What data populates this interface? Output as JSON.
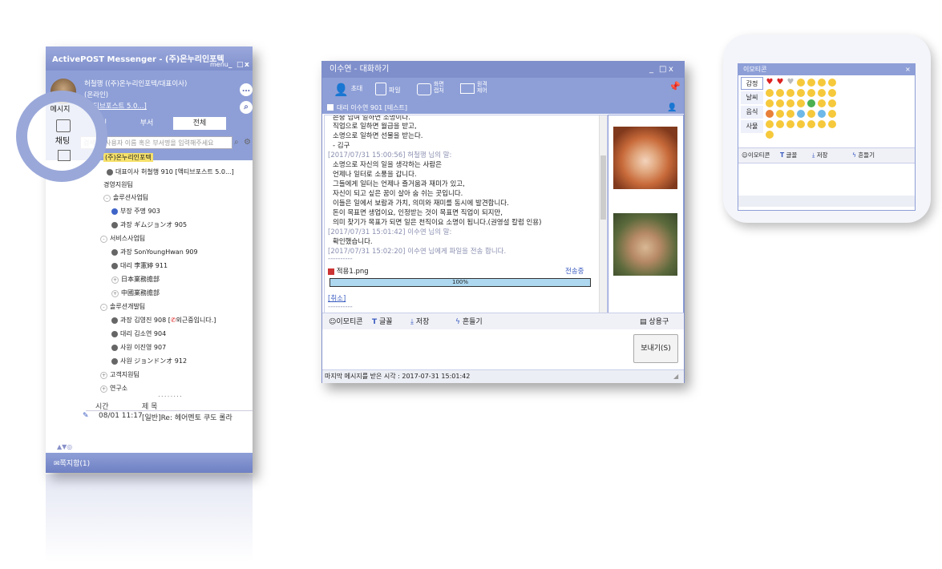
{
  "messenger": {
    "title": "ActivePOST Messenger - (주)온누리인포텍",
    "menu_label": "menu",
    "window_controls": [
      "_",
      "□",
      "x"
    ],
    "profile": {
      "name": "허철행 ((주)온누리인포텍/대표이사)",
      "status": "(온라인)",
      "memo": "[액티브포스트 5.0...]"
    },
    "tabs": [
      {
        "label": "개인"
      },
      {
        "label": "부서"
      },
      {
        "label": "전체",
        "active": true
      }
    ],
    "search": {
      "placeholder": "검색 할 사용자 이름 혹은 부서명을 입력해주세요"
    },
    "side_items": [
      {
        "label": "메시지"
      },
      {
        "label": "채팅"
      }
    ],
    "tree": [
      {
        "text": "(주)온누리인포텍",
        "type": "org"
      },
      {
        "text": "대표이사 허철행 910 [액티브포스트 5.0...]",
        "type": "person"
      },
      {
        "text": "경영지원팀",
        "type": "group"
      },
      {
        "text": "솔루션사업팀",
        "type": "group"
      },
      {
        "text": "부장 주명 903",
        "type": "person",
        "color": "blue"
      },
      {
        "text": "과장 ギムジョンオ 905",
        "type": "person"
      },
      {
        "text": "서비스사업팀",
        "type": "group"
      },
      {
        "text": "과장 SonYoungHwan 909",
        "type": "person"
      },
      {
        "text": "대리 李憲婷 911",
        "type": "person"
      },
      {
        "text": "日本業務擔部",
        "type": "group"
      },
      {
        "text": "中國業務擔部",
        "type": "group"
      },
      {
        "text": "솔루션개발팀",
        "type": "group"
      },
      {
        "text": "과장 김영진 908 [",
        "type": "person",
        "suffix": "외근중입니다.]"
      },
      {
        "text": "대리 김소연 904",
        "type": "person"
      },
      {
        "text": "사원 이진영 907",
        "type": "person"
      },
      {
        "text": "사원 ジョンドンオ 912",
        "type": "person"
      },
      {
        "text": "고객지원팀",
        "type": "group"
      },
      {
        "text": "연구소",
        "type": "group"
      }
    ],
    "mail": {
      "col_time": "시간",
      "col_subject": "제  목",
      "rows": [
        {
          "time": "08/01 11:17",
          "subject": "[일반]Re: 헤어멘토 쿠도 롤라"
        }
      ]
    },
    "status_label": "쪽지함(1)"
  },
  "chat": {
    "title": "이수연 - 대화하기",
    "window_controls": [
      "_",
      "□",
      "x"
    ],
    "toolbar": [
      {
        "label": "초대",
        "icon": "invite-icon"
      },
      {
        "label": "파일",
        "icon": "file-icon"
      },
      {
        "label": "화면\n캡처",
        "icon": "camera-icon"
      },
      {
        "label": "원격\n제어",
        "icon": "monitor-icon"
      }
    ],
    "participant": "대리 이수연 901 [테스트]",
    "log": [
      {
        "text": "존중 님여 일하면 소명이다.",
        "kind": "msg"
      },
      {
        "text": "직업으로 일하면 월급을 받고,",
        "kind": "msg"
      },
      {
        "text": "소명으로 일하면 선물을 받는다.",
        "kind": "msg"
      },
      {
        "text": "- 김구",
        "kind": "msg"
      },
      {
        "text": "[2017/07/31 15:00:56] 허철행 님의 말:",
        "kind": "meta"
      },
      {
        "text": "소명으로 자신의 일을 생각하는 사람은",
        "kind": "msg"
      },
      {
        "text": "언제나 일터로 소풍을 갑니다.",
        "kind": "msg"
      },
      {
        "text": "그들에게 일터는 언제나 즐거움과 재미가 있고,",
        "kind": "msg"
      },
      {
        "text": "자신이 되고 싶은 꿈이 살아 숨 쉬는 곳입니다.",
        "kind": "msg"
      },
      {
        "text": "이들은 일에서 보람과 가치, 의미와 재미를 동시에 발견합니다.",
        "kind": "msg"
      },
      {
        "text": "돈이 목표면 생업이요, 인정받는 것이 목표면 직업이 되지만,",
        "kind": "msg"
      },
      {
        "text": "의미 찾기가 목표가 되면 일은 천직이요 소명이 됩니다.(권영설 칼럼 인용)",
        "kind": "msg"
      },
      {
        "text": "[2017/07/31 15:01:42] 이수연 님의 말:",
        "kind": "meta"
      },
      {
        "text": "확인했습니다.",
        "kind": "msg"
      },
      {
        "text": "[2017/07/31 15:02:20] 이수연 님에게 파일을 전송 합니다.",
        "kind": "meta"
      },
      {
        "text": "----------",
        "kind": "meta"
      }
    ],
    "file": {
      "name": "적용1.png",
      "status": "전송중",
      "progress_label": "100%",
      "progress": 1.0
    },
    "cancel_label": "[취소]",
    "input_tools": [
      {
        "label": "이모티콘"
      },
      {
        "label": "글꼴"
      },
      {
        "label": "저장"
      },
      {
        "label": "흔들기"
      }
    ],
    "phrases_label": "상용구",
    "send_label": "보내기(S)",
    "status_text": "마지막 메시지를 받은 시각 : 2017-07-31 15:01:42"
  },
  "emoticon": {
    "title": "이모티콘",
    "close": "×",
    "categories": [
      {
        "label": "감정",
        "active": true
      },
      {
        "label": "날씨"
      },
      {
        "label": "음식"
      },
      {
        "label": "사물"
      }
    ],
    "tools": [
      {
        "label": "이모티콘"
      },
      {
        "label": "글꼴"
      },
      {
        "label": "저장"
      },
      {
        "label": "흔들기"
      }
    ]
  }
}
